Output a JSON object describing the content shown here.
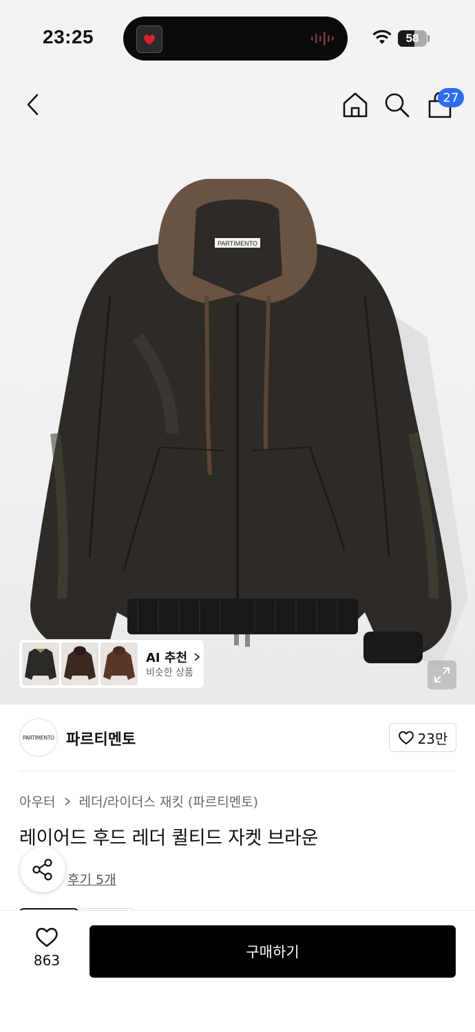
{
  "status_bar": {
    "time": "23:25",
    "battery": "58"
  },
  "header": {
    "cart_count": "27"
  },
  "product_image": {
    "brand_tag": "PARTIMENTO",
    "description": ""
  },
  "ai_recommend": {
    "title": "AI 추천",
    "subtitle": "비슷한 상품",
    "thumbnail_count": 3
  },
  "brand": {
    "logo_text": "PARTIMENTO",
    "name": "파르티멘토",
    "like_count": "23만"
  },
  "product": {
    "breadcrumb_category": "아우터",
    "breadcrumb_sub": "레더/라이더스 재킷 (파르티멘토)",
    "title": "레이어드 후드 레더 퀼티드 자켓 브라운",
    "review_link": "후기 5개"
  },
  "bottom_bar": {
    "wish_count": "863",
    "buy_label": "구매하기"
  },
  "colors": {
    "accent_badge": "#2d6cf0",
    "buy_button": "#000000"
  }
}
